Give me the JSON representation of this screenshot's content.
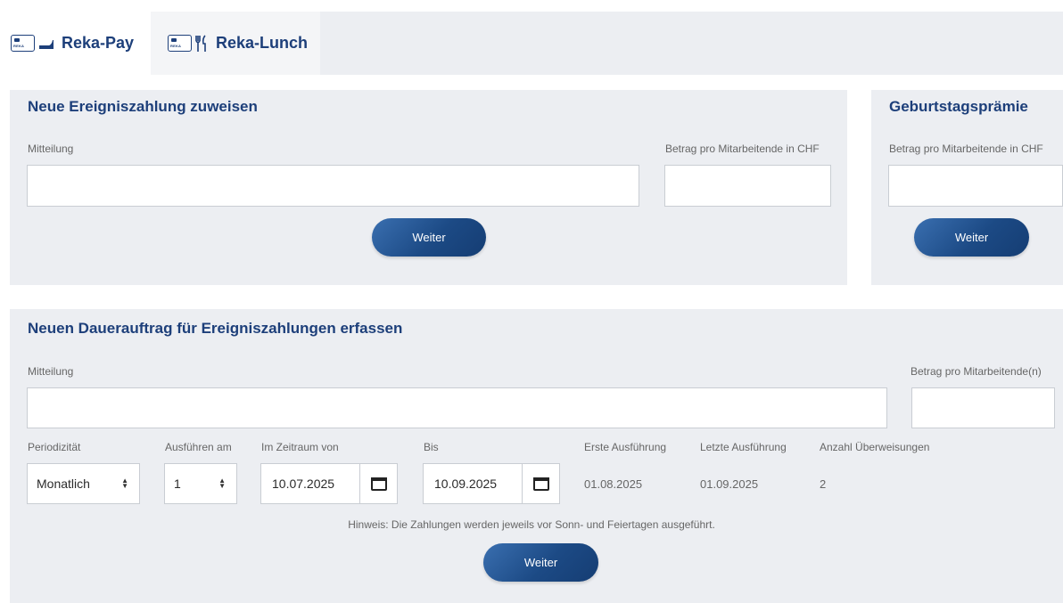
{
  "tabs": [
    {
      "label": "Reka-Pay",
      "icon": "reka-card-pay-icon",
      "active": true
    },
    {
      "label": "Reka-Lunch",
      "icon": "reka-card-lunch-icon",
      "active": false
    }
  ],
  "card_text": "REKA",
  "ereignis": {
    "title": "Neue Ereigniszahlung zuweisen",
    "mitteilung_label": "Mitteilung",
    "mitteilung_value": "",
    "betrag_label": "Betrag pro Mitarbeitende in CHF",
    "betrag_value": "",
    "button": "Weiter"
  },
  "geburtstag": {
    "title": "Geburtstagsprämie",
    "betrag_label": "Betrag pro Mitarbeitende in CHF",
    "betrag_value": "",
    "button": "Weiter"
  },
  "dauerauftrag": {
    "title": "Neuen Dauerauftrag für Ereigniszahlungen erfassen",
    "mitteilung_label": "Mitteilung",
    "mitteilung_value": "",
    "betrag_label": "Betrag pro Mitarbeitende(n)",
    "betrag_value": "",
    "periodizitaet_label": "Periodizität",
    "periodizitaet_value": "Monatlich",
    "ausfuehren_label": "Ausführen am",
    "ausfuehren_value": "1",
    "von_label": "Im Zeitraum von",
    "von_value": "10.07.2025",
    "bis_label": "Bis",
    "bis_value": "10.09.2025",
    "erste_label": "Erste Ausführung",
    "erste_value": "01.08.2025",
    "letzte_label": "Letzte Ausführung",
    "letzte_value": "01.09.2025",
    "anzahl_label": "Anzahl Überweisungen",
    "anzahl_value": "2",
    "hinweis": "Hinweis: Die Zahlungen werden jeweils vor Sonn- und Feiertagen ausgeführt.",
    "button": "Weiter"
  },
  "colors": {
    "brand_blue": "#1d3f7a",
    "button_blue": "#1c4a85",
    "panel_bg": "#eceef2"
  }
}
